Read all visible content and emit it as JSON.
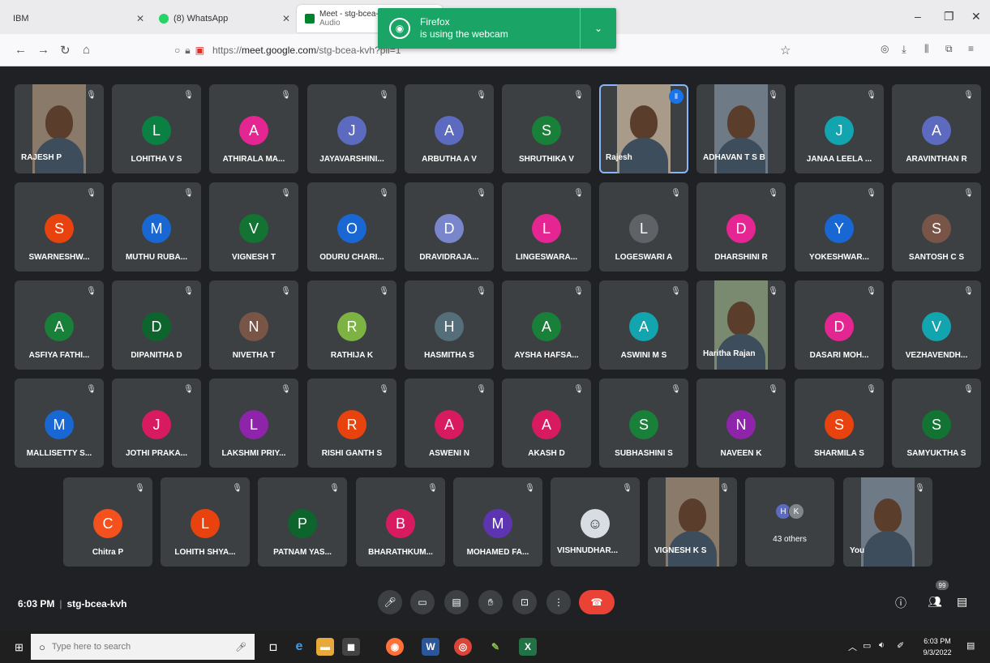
{
  "browser": {
    "tabs": [
      {
        "label": "IBM"
      },
      {
        "label": "(8) WhatsApp"
      },
      {
        "label": "Meet - stg-bcea-kvh",
        "sub": "Audio"
      }
    ],
    "url_prefix": "https://",
    "url_host": "meet.google.com",
    "url_path": "/stg-bcea-kvh?pli=1"
  },
  "notification": {
    "app": "Firefox",
    "message": "is using the webcam"
  },
  "participants_row1": [
    {
      "name": "RAJESH P",
      "type": "video"
    },
    {
      "name": "LOHITHA V S",
      "initial": "L",
      "color": "#0b8043"
    },
    {
      "name": "ATHIRALA MA...",
      "initial": "A",
      "color": "#e52592"
    },
    {
      "name": "JAYAVARSHINI...",
      "initial": "J",
      "color": "#5c6bc0"
    },
    {
      "name": "ARBUTHA A V",
      "initial": "A",
      "color": "#5c6bc0"
    },
    {
      "name": "SHRUTHIKA V",
      "initial": "S",
      "color": "#188038"
    },
    {
      "name": "Rajesh",
      "type": "video",
      "speaking": true
    },
    {
      "name": "ADHAVAN T S B",
      "type": "video"
    },
    {
      "name": "JANAA LEELA ...",
      "initial": "J",
      "color": "#12a4af"
    },
    {
      "name": "ARAVINTHAN R",
      "initial": "A",
      "color": "#5c6bc0"
    }
  ],
  "participants_row2": [
    {
      "name": "SWARNESHW...",
      "initial": "S",
      "color": "#e8430f"
    },
    {
      "name": "MUTHU RUBA...",
      "initial": "M",
      "color": "#1967d2"
    },
    {
      "name": "VIGNESH T",
      "initial": "V",
      "color": "#137333"
    },
    {
      "name": "ODURU CHARI...",
      "initial": "O",
      "color": "#1967d2"
    },
    {
      "name": "DRAVIDRAJA...",
      "initial": "D",
      "color": "#7986cb"
    },
    {
      "name": "LINGESWARA...",
      "initial": "L",
      "color": "#e52592"
    },
    {
      "name": "LOGESWARI A",
      "initial": "L",
      "color": "#5f6368"
    },
    {
      "name": "DHARSHINI R",
      "initial": "D",
      "color": "#e52592"
    },
    {
      "name": "YOKESHWAR...",
      "initial": "Y",
      "color": "#1967d2"
    },
    {
      "name": "SANTOSH C S",
      "initial": "S",
      "color": "#795548"
    }
  ],
  "participants_row3": [
    {
      "name": "ASFIYA FATHI...",
      "initial": "A",
      "color": "#188038"
    },
    {
      "name": "DIPANITHA D",
      "initial": "D",
      "color": "#0d652d"
    },
    {
      "name": "NIVETHA T",
      "initial": "N",
      "color": "#795548"
    },
    {
      "name": "RATHIJA K",
      "initial": "R",
      "color": "#7cb342"
    },
    {
      "name": "HASMITHA S",
      "initial": "H",
      "color": "#546e7a"
    },
    {
      "name": "AYSHA HAFSA...",
      "initial": "A",
      "color": "#188038"
    },
    {
      "name": "ASWINI M S",
      "initial": "A",
      "color": "#12a4af"
    },
    {
      "name": "Haritha Rajan",
      "type": "video"
    },
    {
      "name": "DASARI MOH...",
      "initial": "D",
      "color": "#e52592"
    },
    {
      "name": "VEZHAVENDH...",
      "initial": "V",
      "color": "#12a4af"
    }
  ],
  "participants_row4": [
    {
      "name": "MALLISETTY S...",
      "initial": "M",
      "color": "#1967d2"
    },
    {
      "name": "JOTHI PRAKA...",
      "initial": "J",
      "color": "#d81b60"
    },
    {
      "name": "LAKSHMI PRIY...",
      "initial": "L",
      "color": "#8e24aa"
    },
    {
      "name": "RISHI GANTH S",
      "initial": "R",
      "color": "#e8430f"
    },
    {
      "name": "ASWENI N",
      "initial": "A",
      "color": "#d81b60"
    },
    {
      "name": "AKASH D",
      "initial": "A",
      "color": "#d81b60"
    },
    {
      "name": "SUBHASHINI S",
      "initial": "S",
      "color": "#188038"
    },
    {
      "name": "NAVEEN K",
      "initial": "N",
      "color": "#8e24aa"
    },
    {
      "name": "SHARMILA S",
      "initial": "S",
      "color": "#e8430f"
    },
    {
      "name": "SAMYUKTHA S",
      "initial": "S",
      "color": "#137333"
    }
  ],
  "participants_row5": [
    {
      "name": "Chitra P",
      "initial": "C",
      "color": "#f4511e"
    },
    {
      "name": "LOHITH SHYA...",
      "initial": "L",
      "color": "#e8430f"
    },
    {
      "name": "PATNAM YAS...",
      "initial": "P",
      "color": "#0d652d"
    },
    {
      "name": "BHARATHKUM...",
      "initial": "B",
      "color": "#d81b60"
    },
    {
      "name": "MOHAMED FA...",
      "initial": "M",
      "color": "#5e35b1"
    },
    {
      "name": "VISHNUDHAR...",
      "type": "photo"
    },
    {
      "name": "VIGNESH K S",
      "type": "video"
    },
    {
      "name": "43 others",
      "type": "others",
      "mini": [
        {
          "initial": "H",
          "color": "#5c6bc0"
        },
        {
          "initial": "K",
          "color": "#80868b"
        }
      ]
    },
    {
      "name": "You",
      "type": "video"
    }
  ],
  "meeting": {
    "time": "6:03 PM",
    "code": "stg-bcea-kvh",
    "people_count": "99"
  },
  "taskbar": {
    "search_placeholder": "Type here to search",
    "clock_time": "6:03 PM",
    "clock_date": "9/3/2022"
  }
}
